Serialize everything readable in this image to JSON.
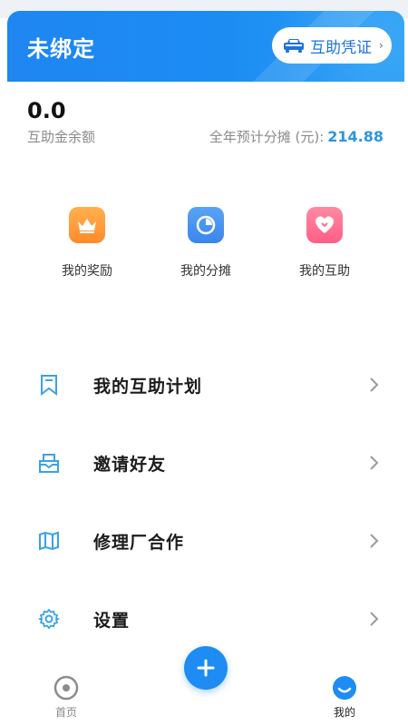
{
  "header": {
    "title": "未绑定",
    "voucher_label": "互助凭证",
    "voucher_chevron": "›",
    "gradient_start": "#1f86f2",
    "gradient_end": "#2aa0f5"
  },
  "balance": {
    "value": "0.0",
    "label": "互助金余额"
  },
  "annual_share": {
    "label": "全年预计分摊 (元):",
    "amount": "214.88",
    "accent": "#2c95e3"
  },
  "quick_actions": [
    {
      "label": "我的奖励",
      "icon": "crown-icon",
      "color": "#ff9a3c"
    },
    {
      "label": "我的分摊",
      "icon": "pie-chart-icon",
      "color": "#3f8ff0"
    },
    {
      "label": "我的互助",
      "icon": "heart-icon",
      "color": "#ff6f8e"
    }
  ],
  "menu": [
    {
      "label": "我的互助计划",
      "icon": "bookmark-icon"
    },
    {
      "label": "邀请好友",
      "icon": "invite-envelope-icon"
    },
    {
      "label": "修理厂合作",
      "icon": "map-book-icon"
    },
    {
      "label": "设置",
      "icon": "gear-icon"
    }
  ],
  "bottom_nav": {
    "home_label": "首页",
    "mine_label": "我的",
    "active_color": "#1e8cf2",
    "inactive_color": "#888888"
  }
}
